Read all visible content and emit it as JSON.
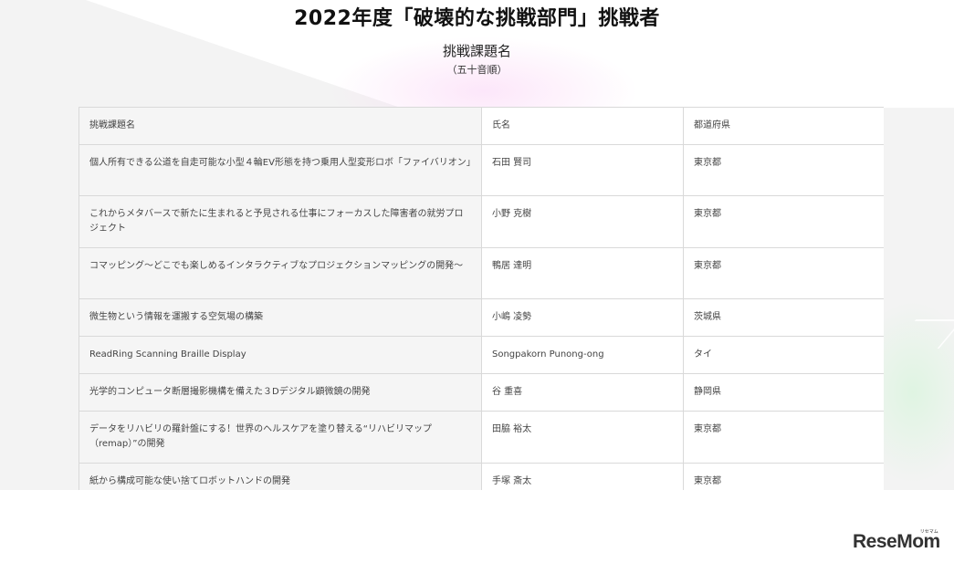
{
  "header": {
    "title": "2022年度「破壊的な挑戦部門」挑戦者",
    "subtitle": "挑戦課題名",
    "note": "（五十音順）"
  },
  "table": {
    "columns": [
      "挑戦課題名",
      "氏名",
      "都道府県"
    ],
    "rows": [
      {
        "theme": "個人所有できる公道を自走可能な小型４輪EV形態を持つ乗用人型変形ロボ「ファイバリオン」",
        "name": "石田 賢司",
        "pref": "東京都"
      },
      {
        "theme": "これからメタバースで新たに生まれると予見される仕事にフォーカスした障害者の就労プロジェクト",
        "name": "小野 克樹",
        "pref": "東京都"
      },
      {
        "theme": "コマッピング～どこでも楽しめるインタラクティブなプロジェクションマッピングの開発～",
        "name": "鴨居 達明",
        "pref": "東京都"
      },
      {
        "theme": "微生物という情報を運搬する空気場の構築",
        "name": "小嶋 凌勢",
        "pref": "茨城県"
      },
      {
        "theme": "ReadRing Scanning Braille Display",
        "name": "Songpakorn Punong-ong",
        "pref": "タイ"
      },
      {
        "theme": "光学的コンピュータ断層撮影機構を備えた３Dデジタル顕微鏡の開発",
        "name": "谷 重喜",
        "pref": "静岡県"
      },
      {
        "theme": "データをリハビリの羅針盤にする！世界のヘルスケアを塗り替える“リハビリマップ（remap）”の開発",
        "name": "田脇 裕太",
        "pref": "東京都"
      },
      {
        "theme": "紙から構成可能な使い捨てロボットハンドの開発",
        "name": "手塚 斎太",
        "pref": "東京都"
      }
    ]
  },
  "logo": {
    "text": "ReseMom",
    "kana": "リセマム"
  }
}
